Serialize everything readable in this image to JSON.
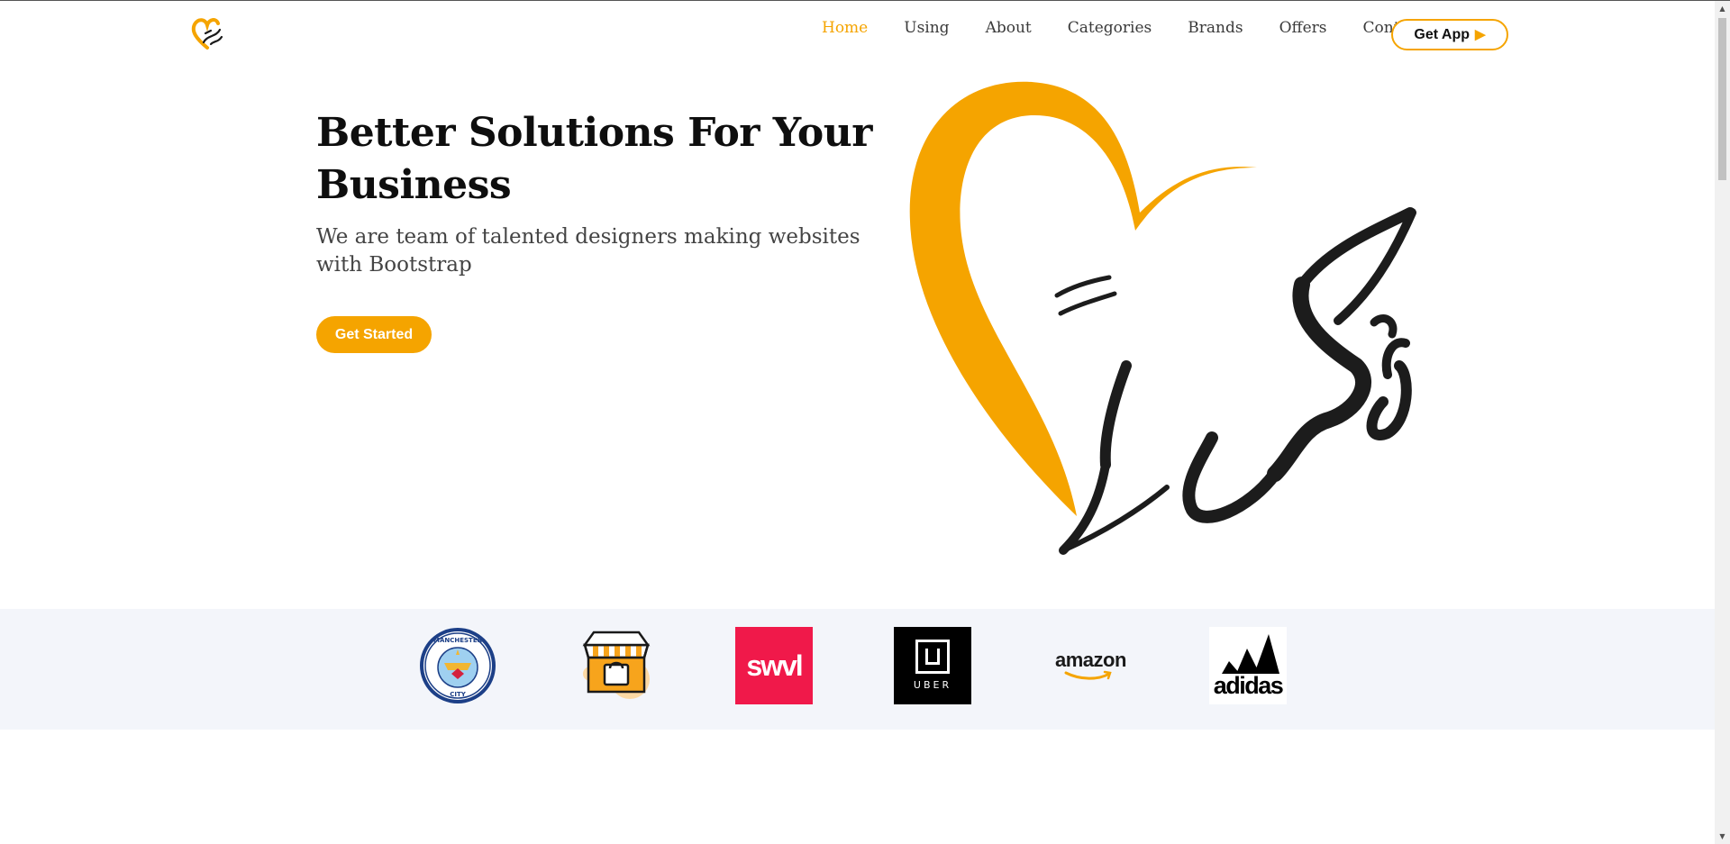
{
  "nav": {
    "items": [
      {
        "label": "Home",
        "active": true
      },
      {
        "label": "Using",
        "active": false
      },
      {
        "label": "About",
        "active": false
      },
      {
        "label": "Categories",
        "active": false
      },
      {
        "label": "Brands",
        "active": false
      },
      {
        "label": "Offers",
        "active": false
      },
      {
        "label": "Contact",
        "active": false
      }
    ],
    "cta_label": "Get App"
  },
  "hero": {
    "title": "Better Solutions For Your Business",
    "subtitle": "We are team of talented designers making websites with Bootstrap",
    "button_label": "Get Started"
  },
  "clients": [
    {
      "icon": "manchester-city-logo",
      "text_top": "MANCHESTER",
      "text_bottom": "CITY"
    },
    {
      "icon": "shop-bag-logo"
    },
    {
      "icon": "swvl-logo",
      "text": "swvl"
    },
    {
      "icon": "uber-logo",
      "text": "UBER"
    },
    {
      "icon": "amazon-logo",
      "text": "amazon"
    },
    {
      "icon": "adidas-logo",
      "text": "adidas"
    }
  ],
  "colors": {
    "accent": "#f5a400",
    "text_dark": "#0e0e0e",
    "text_muted": "#444444",
    "clients_bg": "#f3f5fa",
    "swvl_red": "#f0194a"
  }
}
